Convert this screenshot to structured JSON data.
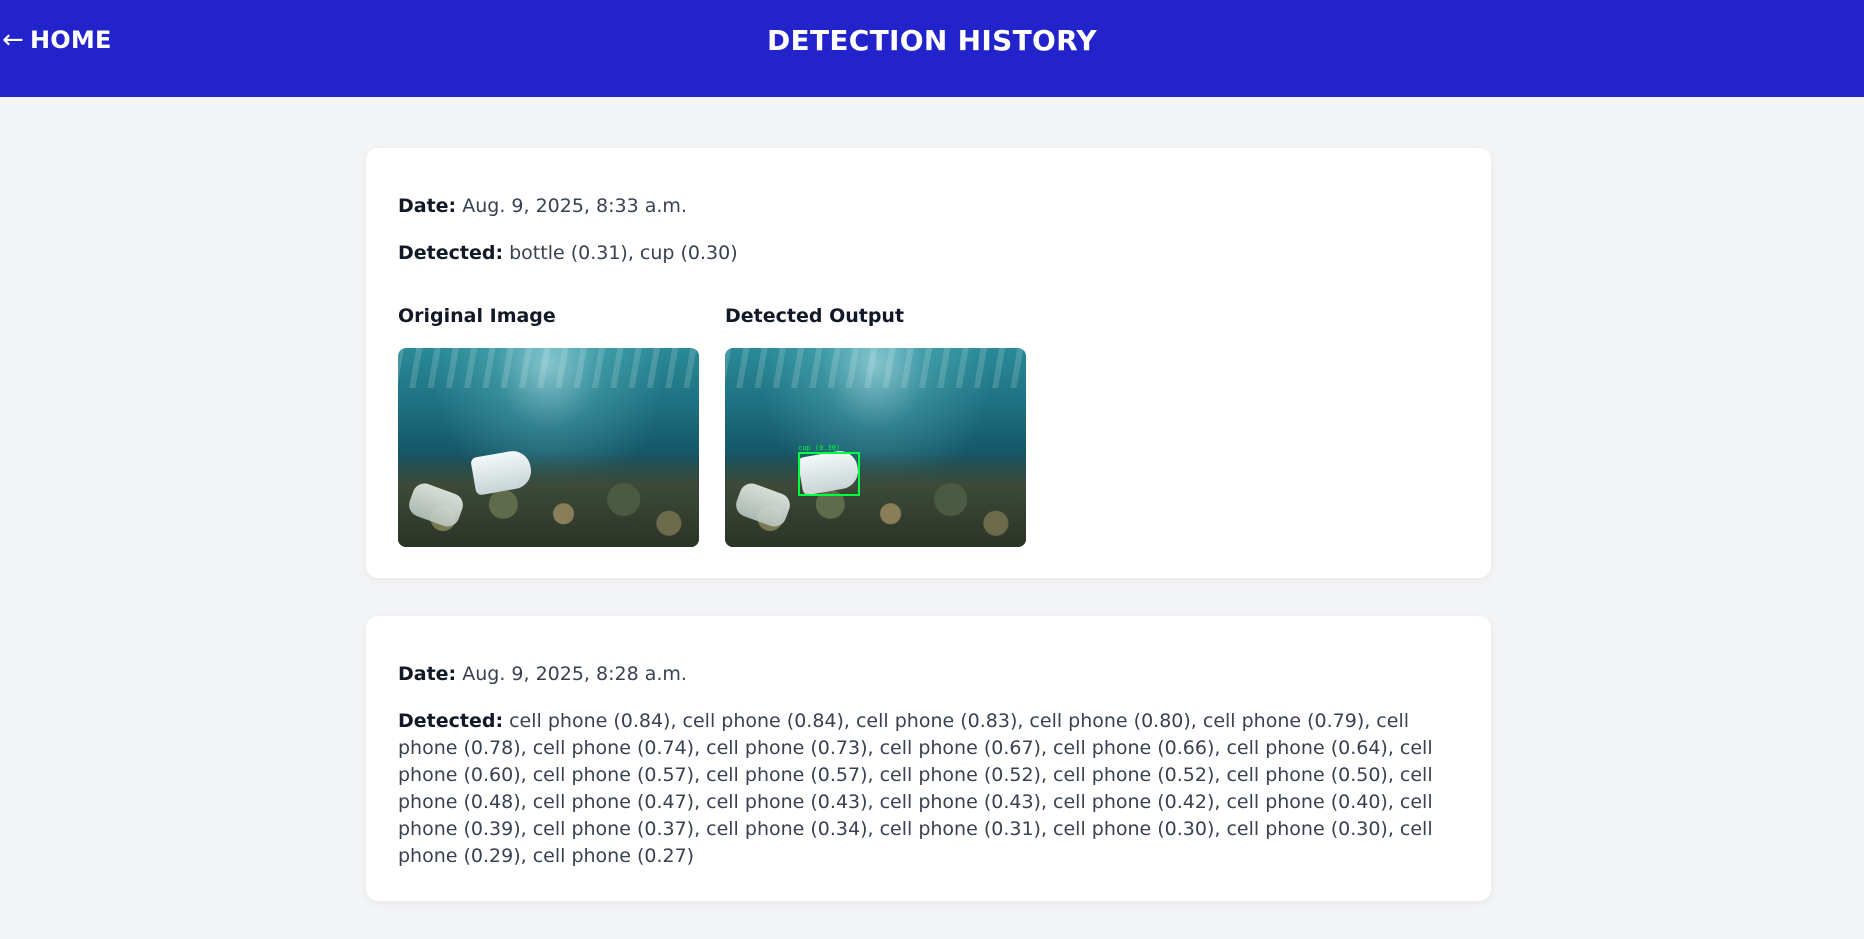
{
  "header": {
    "home_label": "HOME",
    "arrow_glyph": "←",
    "title": "DETECTION HISTORY",
    "background_color": "#2323cc"
  },
  "labels": {
    "date": "Date:",
    "detected": "Detected:",
    "original_image": "Original Image",
    "detected_output": "Detected Output"
  },
  "records": [
    {
      "date": "Aug. 9, 2025, 8:33 a.m.",
      "detected": "bottle (0.31), cup (0.30)",
      "box_label": "cup (0.30)"
    },
    {
      "date": "Aug. 9, 2025, 8:28 a.m.",
      "detected": "cell phone (0.84), cell phone (0.84), cell phone (0.83), cell phone (0.80), cell phone (0.79), cell phone (0.78), cell phone (0.74), cell phone (0.73), cell phone (0.67), cell phone (0.66), cell phone (0.64), cell phone (0.60), cell phone (0.57), cell phone (0.57), cell phone (0.52), cell phone (0.52), cell phone (0.50), cell phone (0.48), cell phone (0.47), cell phone (0.43), cell phone (0.43), cell phone (0.42), cell phone (0.40), cell phone (0.39), cell phone (0.37), cell phone (0.34), cell phone (0.31), cell phone (0.30), cell phone (0.30), cell phone (0.29), cell phone (0.27)"
    }
  ]
}
